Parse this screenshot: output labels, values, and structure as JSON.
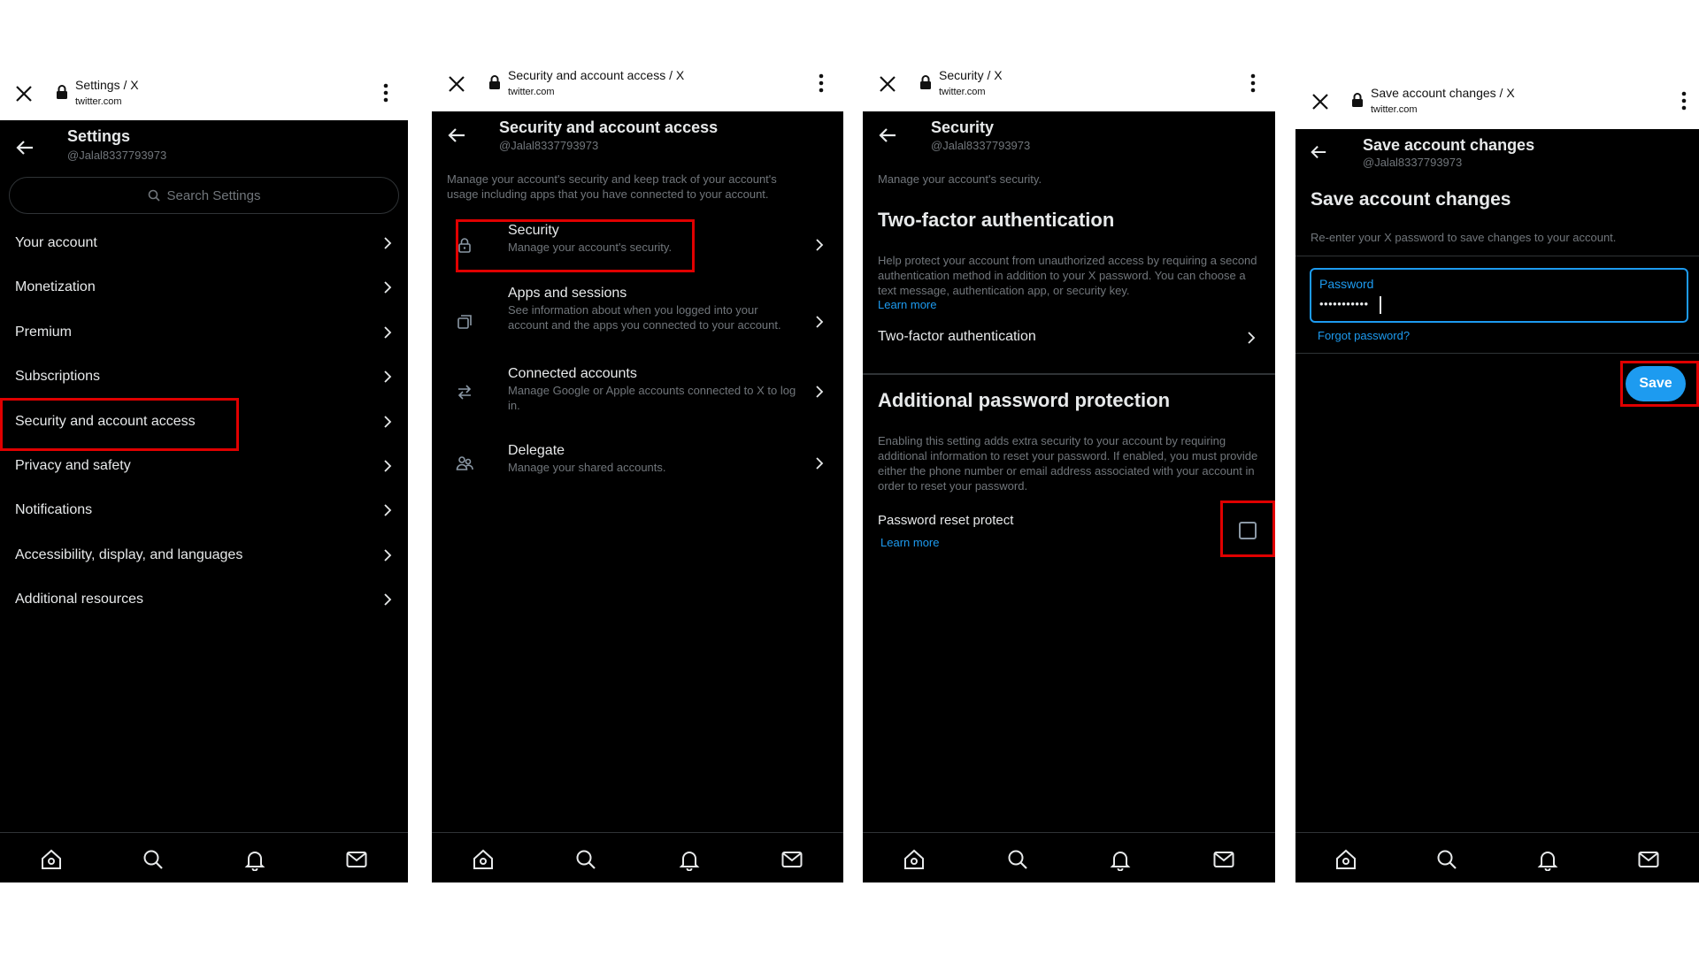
{
  "panels": [
    {
      "browser_title": "Settings / X",
      "browser_url": "twitter.com",
      "title": "Settings",
      "handle": "@Jalal8337793973",
      "search_placeholder": "Search Settings",
      "items": [
        "Your account",
        "Monetization",
        "Premium",
        "Subscriptions",
        "Security and account access",
        "Privacy and safety",
        "Notifications",
        "Accessibility, display, and languages",
        "Additional resources"
      ]
    },
    {
      "browser_title": "Security and account access / X",
      "browser_url": "twitter.com",
      "title": "Security and account access",
      "handle": "@Jalal8337793973",
      "description": "Manage your account's security and keep track of your account's usage including apps that you have connected to your account.",
      "items": [
        {
          "title": "Security",
          "subtitle": "Manage your account's security.",
          "icon": "lock-icon"
        },
        {
          "title": "Apps and sessions",
          "subtitle": "See information about when you logged into your account and the apps you connected to your account.",
          "icon": "apps-icon"
        },
        {
          "title": "Connected accounts",
          "subtitle": "Manage Google or Apple accounts connected to X to log in.",
          "icon": "arrows-icon"
        },
        {
          "title": "Delegate",
          "subtitle": "Manage your shared accounts.",
          "icon": "people-icon"
        }
      ]
    },
    {
      "browser_title": "Security / X",
      "browser_url": "twitter.com",
      "title": "Security",
      "handle": "@Jalal8337793973",
      "description": "Manage your account's security.",
      "twofa_heading": "Two-factor authentication",
      "twofa_text": "Help protect your account from unauthorized access by requiring a second authentication method in addition to your X password. You can choose a text message, authentication app, or security key.",
      "twofa_learn_more": "Learn more",
      "twofa_row": "Two-factor authentication",
      "app_heading": "Additional password protection",
      "app_text": "Enabling this setting adds extra security to your account by requiring additional information to reset your password. If enabled, you must provide either the phone number or email address associated with your account in order to reset your password.",
      "reset_protect_label": "Password reset protect",
      "reset_learn_more": "Learn more",
      "reset_protect_checked": false
    },
    {
      "browser_title": "Save account changes / X",
      "browser_url": "twitter.com",
      "title": "Save account changes",
      "handle": "@Jalal8337793973",
      "heading": "Save account changes",
      "description": "Re-enter your X password to save changes to your account.",
      "password_label": "Password",
      "password_value": "•••••••••••",
      "forgot_password": "Forgot password?",
      "save_label": "Save"
    }
  ],
  "colors": {
    "accent": "#1d9bf0",
    "highlight": "#e00000",
    "background": "#000000",
    "muted": "#71767b"
  }
}
